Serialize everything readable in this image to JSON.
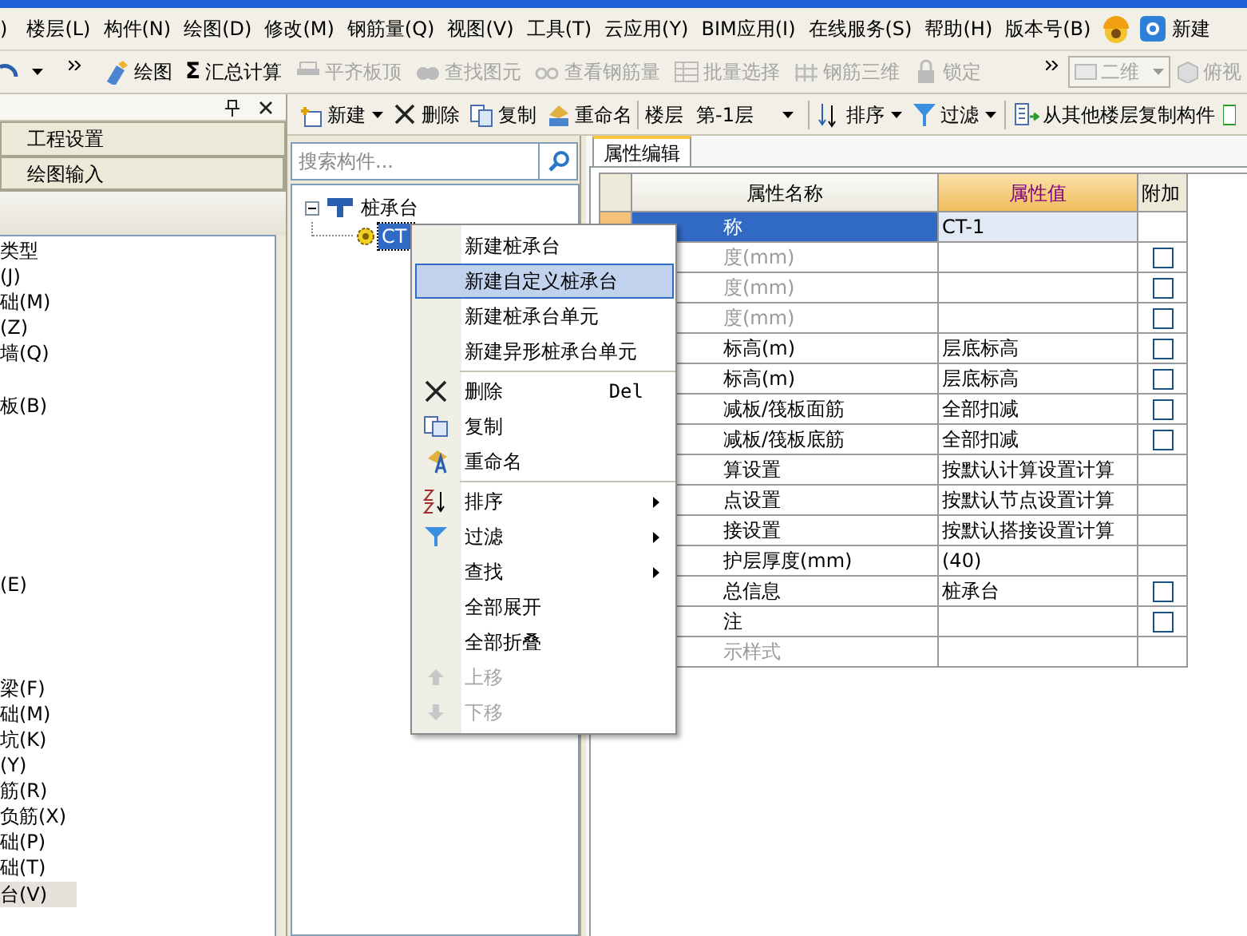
{
  "menu_bar": {
    "items": [
      ")",
      "楼层(L)",
      "构件(N)",
      "绘图(D)",
      "修改(M)",
      "钢筋量(Q)",
      "视图(V)",
      "工具(T)",
      "云应用(Y)",
      "BIM应用(I)",
      "在线服务(S)",
      "帮助(H)",
      "版本号(B)"
    ],
    "trailing_button": "新建"
  },
  "toolbar": {
    "items": [
      {
        "kind": "icon_button",
        "label": "绘图",
        "disabled": false
      },
      {
        "kind": "glyph_button",
        "glyph": "Σ",
        "label": "汇总计算",
        "disabled": false
      },
      {
        "kind": "icon_button",
        "label": "平齐板顶",
        "disabled": true
      },
      {
        "kind": "icon_button",
        "label": "查找图元",
        "disabled": true
      },
      {
        "kind": "icon_button",
        "label": "查看钢筋量",
        "disabled": true
      },
      {
        "kind": "icon_button",
        "label": "批量选择",
        "disabled": true
      },
      {
        "kind": "icon_button",
        "label": "钢筋三维",
        "disabled": true
      },
      {
        "kind": "icon_button",
        "label": "锁定",
        "disabled": true
      }
    ],
    "view_select": {
      "value": "二维",
      "disabled": true
    },
    "view_button": {
      "label": "俯视",
      "disabled": true
    }
  },
  "left_panel": {
    "buttons": [
      "工程设置",
      "绘图输入"
    ],
    "items": [
      {
        "label": "类型",
        "selected": false
      },
      {
        "label": "(J)",
        "selected": false
      },
      {
        "label": "础(M)",
        "selected": false
      },
      {
        "label": "(Z)",
        "selected": false
      },
      {
        "label": "墙(Q)",
        "selected": false
      },
      {
        "label": "板(B)",
        "selected": false
      },
      {
        "label": "(E)",
        "selected": false
      },
      {
        "label": "梁(F)",
        "selected": false
      },
      {
        "label": "础(M)",
        "selected": false
      },
      {
        "label": "坑(K)",
        "selected": false
      },
      {
        "label": "(Y)",
        "selected": false
      },
      {
        "label": "筋(R)",
        "selected": false
      },
      {
        "label": "负筋(X)",
        "selected": false
      },
      {
        "label": "础(P)",
        "selected": false
      },
      {
        "label": "础(T)",
        "selected": false
      },
      {
        "label": "台(V)",
        "selected": true
      }
    ]
  },
  "component_toolbar": {
    "items": [
      {
        "kind": "button",
        "label": "新建",
        "dropdown": true
      },
      {
        "kind": "button",
        "label": "删除",
        "dropdown": false
      },
      {
        "kind": "button",
        "label": "复制",
        "dropdown": false
      },
      {
        "kind": "button",
        "label": "重命名",
        "dropdown": false
      },
      {
        "kind": "label",
        "label": "楼层"
      },
      {
        "kind": "select",
        "label": "第-1层"
      },
      {
        "kind": "button",
        "label": "排序",
        "dropdown": true
      },
      {
        "kind": "button",
        "label": "过滤",
        "dropdown": true
      },
      {
        "kind": "button",
        "label": "从其他楼层复制构件",
        "dropdown": false
      }
    ]
  },
  "search": {
    "placeholder": "搜索构件..."
  },
  "tree": [
    {
      "label": "桩承台",
      "expanded": true,
      "children": [
        {
          "label": "CT",
          "selected": true
        }
      ]
    }
  ],
  "property_panel": {
    "tabs": [
      {
        "label": "属性编辑",
        "selected": true
      }
    ],
    "columns": [
      "属性名称",
      "属性值",
      "附加"
    ],
    "rows": [
      {
        "name": "称",
        "value": "CT-1",
        "selected": true,
        "disabled": false
      },
      {
        "name": "度(mm)",
        "selected": false,
        "disabled": true,
        "checked": false
      },
      {
        "name": "度(mm)",
        "selected": false,
        "disabled": true,
        "checked": false
      },
      {
        "name": "度(mm)",
        "selected": false,
        "disabled": true,
        "checked": false
      },
      {
        "name": "标高(m)",
        "value": "层底标高",
        "selected": false,
        "disabled": false,
        "checked": false
      },
      {
        "name": "标高(m)",
        "value": "层底标高",
        "selected": false,
        "disabled": false,
        "checked": false
      },
      {
        "name": "减板/筏板面筋",
        "value": "全部扣减",
        "selected": false,
        "disabled": false,
        "checked": false
      },
      {
        "name": "减板/筏板底筋",
        "value": "全部扣减",
        "selected": false,
        "disabled": false,
        "checked": false
      },
      {
        "name": "算设置",
        "value": "按默认计算设置计算",
        "selected": false,
        "disabled": false
      },
      {
        "name": "点设置",
        "value": "按默认节点设置计算",
        "selected": false,
        "disabled": false
      },
      {
        "name": "接设置",
        "value": "按默认搭接设置计算",
        "selected": false,
        "disabled": false
      },
      {
        "name": "护层厚度(mm)",
        "value": "(40)",
        "selected": false,
        "disabled": false
      },
      {
        "name": "总信息",
        "value": "桩承台",
        "selected": false,
        "disabled": false,
        "checked": false
      },
      {
        "name": "注",
        "selected": false,
        "disabled": false,
        "checked": false
      },
      {
        "name": "示样式",
        "selected": false,
        "disabled": true
      }
    ]
  },
  "context_menu": {
    "items": [
      {
        "kind": "item",
        "label": "新建桩承台",
        "selected": false,
        "disabled": false
      },
      {
        "kind": "item",
        "label": "新建自定义桩承台",
        "selected": true,
        "disabled": false
      },
      {
        "kind": "item",
        "label": "新建桩承台单元",
        "selected": false,
        "disabled": false
      },
      {
        "kind": "item",
        "label": "新建异形桩承台单元",
        "selected": false,
        "disabled": false
      },
      {
        "kind": "separator"
      },
      {
        "kind": "item",
        "label": "删除",
        "shortcut": "Del",
        "selected": false,
        "disabled": false
      },
      {
        "kind": "item",
        "label": "复制",
        "selected": false,
        "disabled": false
      },
      {
        "kind": "item",
        "label": "重命名",
        "selected": false,
        "disabled": false
      },
      {
        "kind": "separator"
      },
      {
        "kind": "item",
        "label": "排序",
        "submenu": true,
        "selected": false,
        "disabled": false
      },
      {
        "kind": "item",
        "label": "过滤",
        "submenu": true,
        "selected": false,
        "disabled": false
      },
      {
        "kind": "item",
        "label": "查找",
        "submenu": true,
        "selected": false,
        "disabled": false
      },
      {
        "kind": "item",
        "label": "全部展开",
        "selected": false,
        "disabled": false
      },
      {
        "kind": "item",
        "label": "全部折叠",
        "selected": false,
        "disabled": false
      },
      {
        "kind": "item",
        "label": "上移",
        "selected": false,
        "disabled": true
      },
      {
        "kind": "item",
        "label": "下移",
        "selected": false,
        "disabled": true
      }
    ]
  }
}
